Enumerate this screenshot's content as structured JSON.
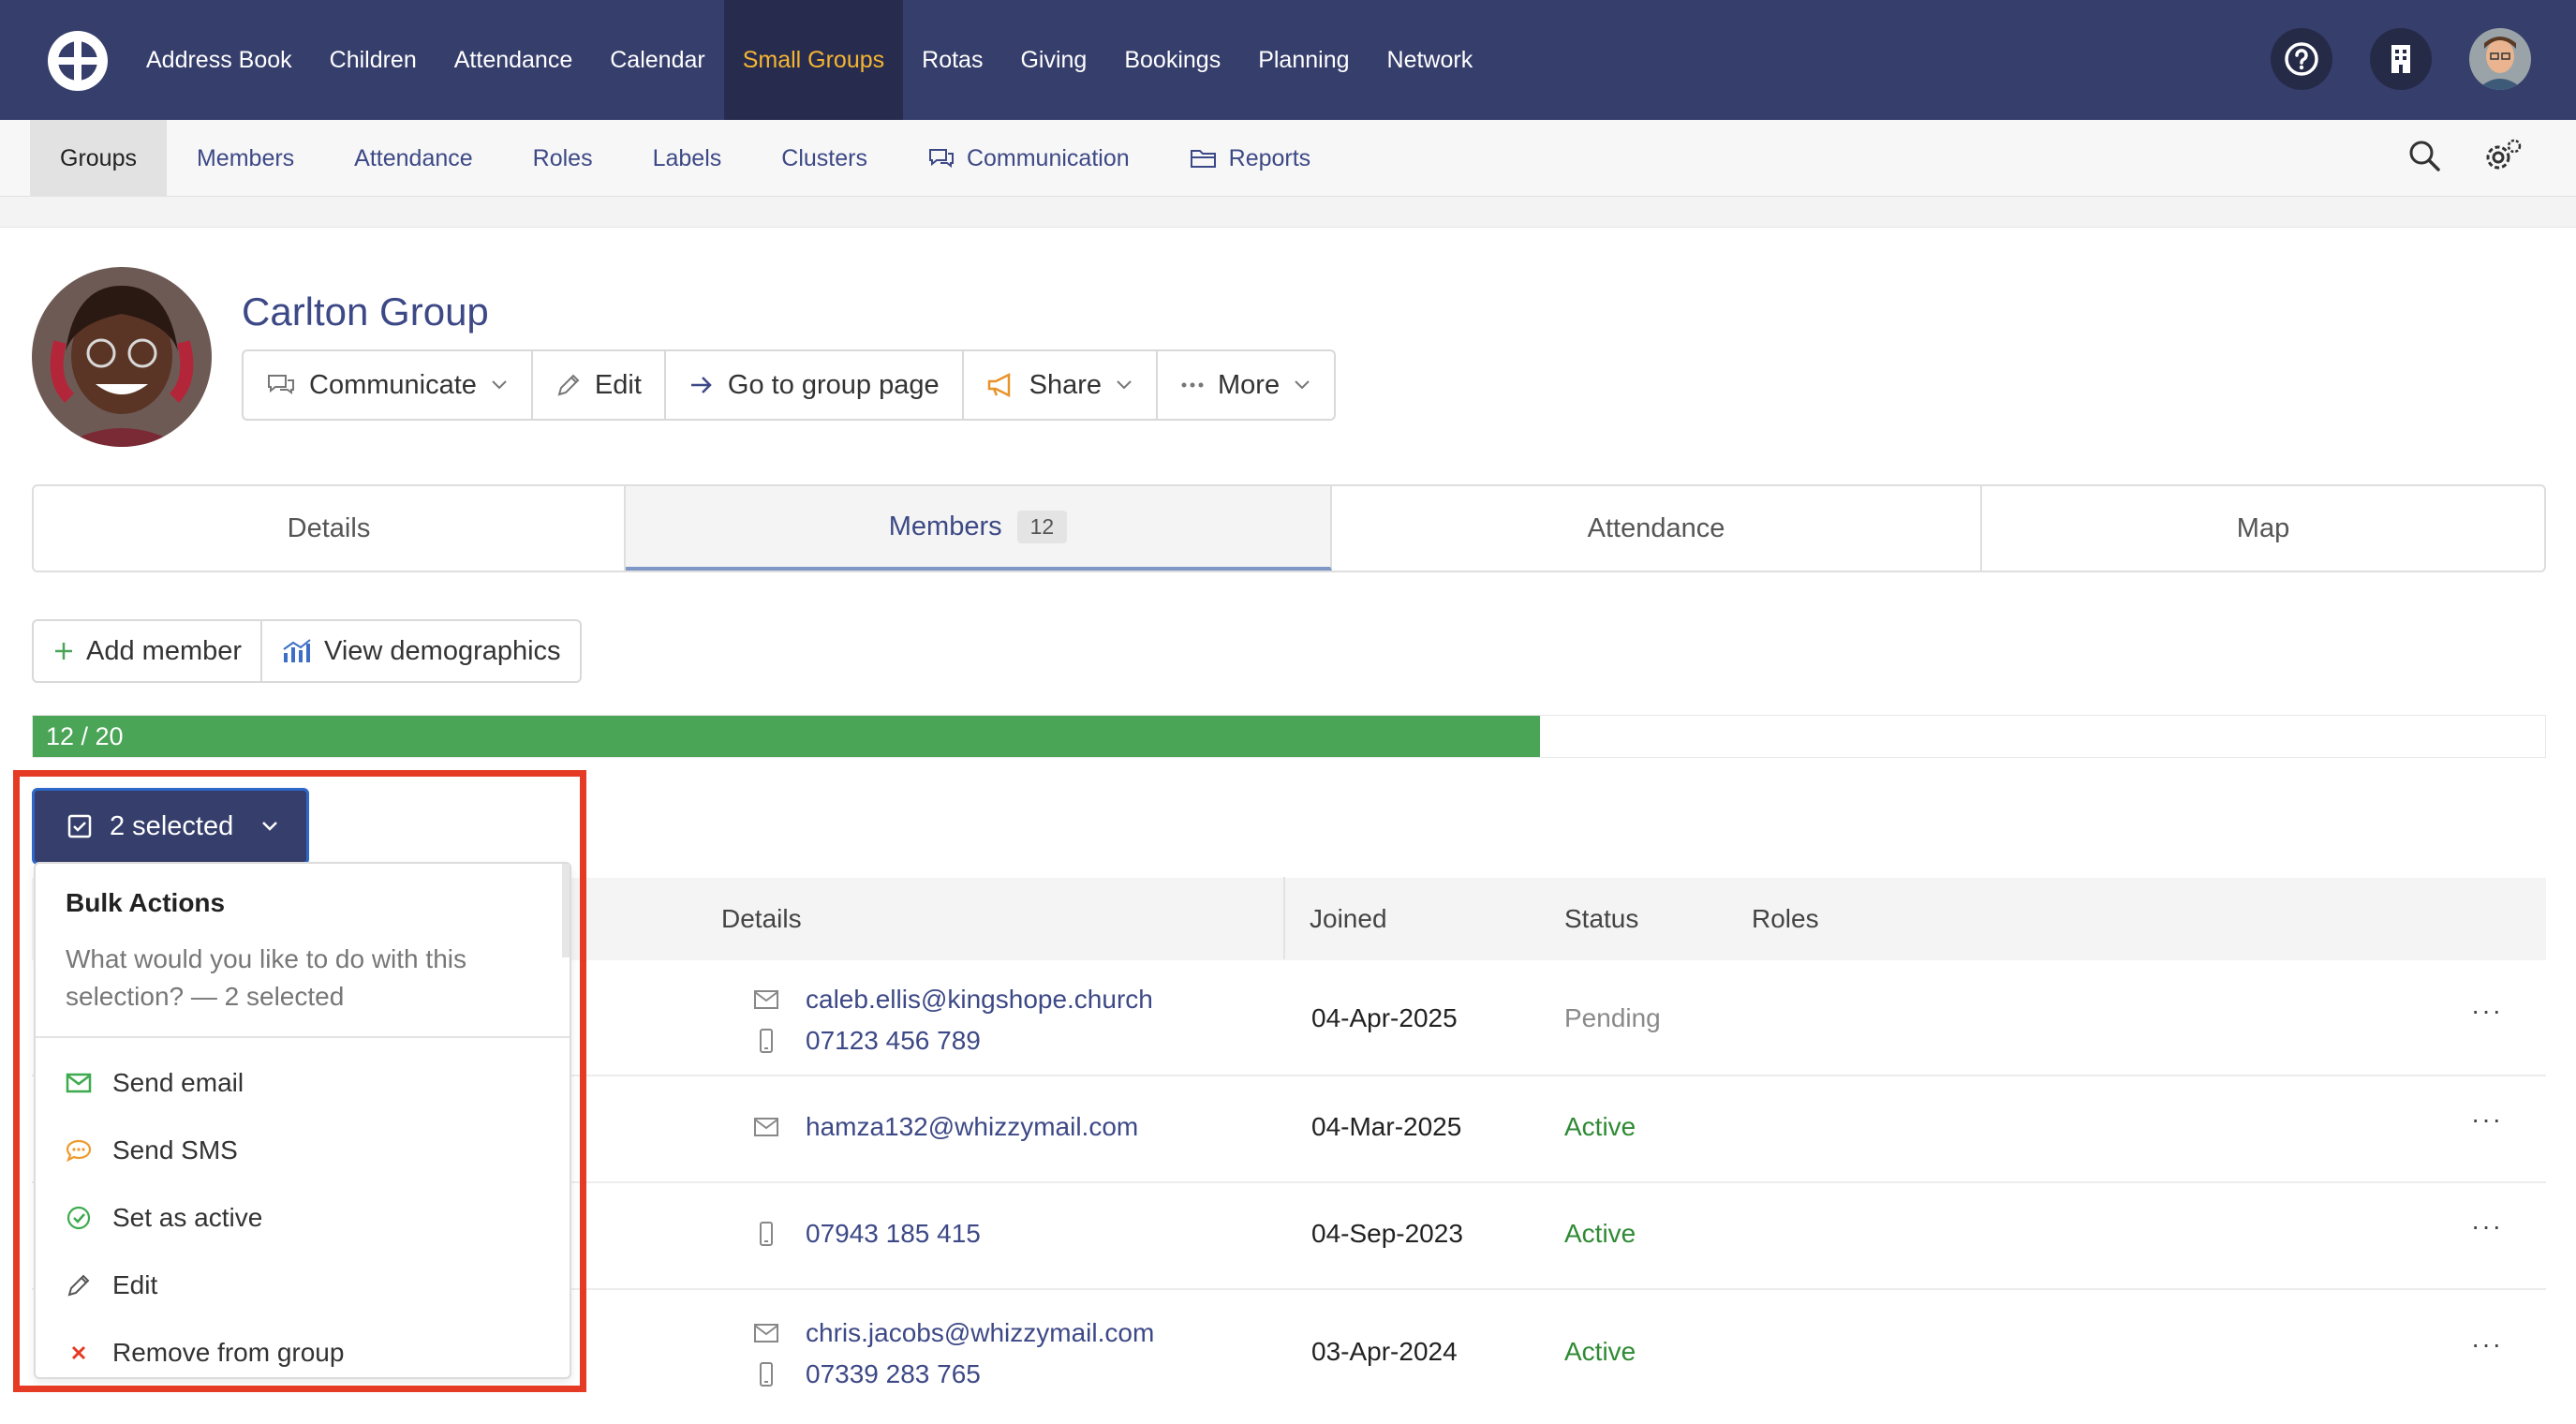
{
  "colors": {
    "nav_bg": "#363e6c",
    "active_nav": "#f6b531",
    "link": "#3d4986",
    "active_status": "#2f8a34",
    "progress": "#4aa557",
    "highlight": "#e53b24"
  },
  "topnav": {
    "items": [
      {
        "label": "Address Book"
      },
      {
        "label": "Children"
      },
      {
        "label": "Attendance"
      },
      {
        "label": "Calendar"
      },
      {
        "label": "Small Groups"
      },
      {
        "label": "Rotas"
      },
      {
        "label": "Giving"
      },
      {
        "label": "Bookings"
      },
      {
        "label": "Planning"
      },
      {
        "label": "Network"
      }
    ],
    "active_index": 4,
    "icons": [
      "help-icon",
      "building-icon",
      "user-avatar"
    ]
  },
  "subnav": {
    "items": [
      {
        "label": "Groups"
      },
      {
        "label": "Members"
      },
      {
        "label": "Attendance"
      },
      {
        "label": "Roles"
      },
      {
        "label": "Labels"
      },
      {
        "label": "Clusters"
      },
      {
        "label": "Communication",
        "icon": "chat-icon"
      },
      {
        "label": "Reports",
        "icon": "folder-icon"
      }
    ],
    "icons": [
      "search-icon",
      "settings-icon"
    ]
  },
  "group": {
    "title": "Carlton Group",
    "buttons": {
      "communicate": "Communicate",
      "edit": "Edit",
      "go_to_page": "Go to group page",
      "share": "Share",
      "more": "More"
    }
  },
  "tabs": {
    "details": "Details",
    "members": "Members",
    "members_count": "12",
    "attendance": "Attendance",
    "map": "Map"
  },
  "actions": {
    "add_member": "Add member",
    "view_demographics": "View demographics"
  },
  "capacity": {
    "label": "12 / 20",
    "filled": 12,
    "total": 20
  },
  "selection": {
    "label": "2 selected"
  },
  "table": {
    "headers": {
      "details": "Details",
      "joined": "Joined",
      "status": "Status",
      "roles": "Roles"
    },
    "rows": [
      {
        "email": "caleb.ellis@kingshope.church",
        "phone": "07123 456 789",
        "joined": "04-Apr-2025",
        "status": "Pending"
      },
      {
        "email": "hamza132@whizzymail.com",
        "phone": "",
        "joined": "04-Mar-2025",
        "status": "Active"
      },
      {
        "email": "",
        "phone": "07943 185 415",
        "joined": "04-Sep-2023",
        "status": "Active"
      },
      {
        "email": "chris.jacobs@whizzymail.com",
        "phone": "07339 283 765",
        "joined": "03-Apr-2024",
        "status": "Active"
      }
    ],
    "row_menu": "···"
  },
  "bulk": {
    "title": "Bulk Actions",
    "subtitle": "What would you like to do with this selection? — 2 selected",
    "items": [
      {
        "label": "Send email",
        "icon": "envelope-icon"
      },
      {
        "label": "Send SMS",
        "icon": "sms-icon"
      },
      {
        "label": "Set as active",
        "icon": "check-circle-icon"
      },
      {
        "label": "Edit",
        "icon": "pencil-icon"
      },
      {
        "label": "Remove from group",
        "icon": "x-icon"
      }
    ]
  }
}
